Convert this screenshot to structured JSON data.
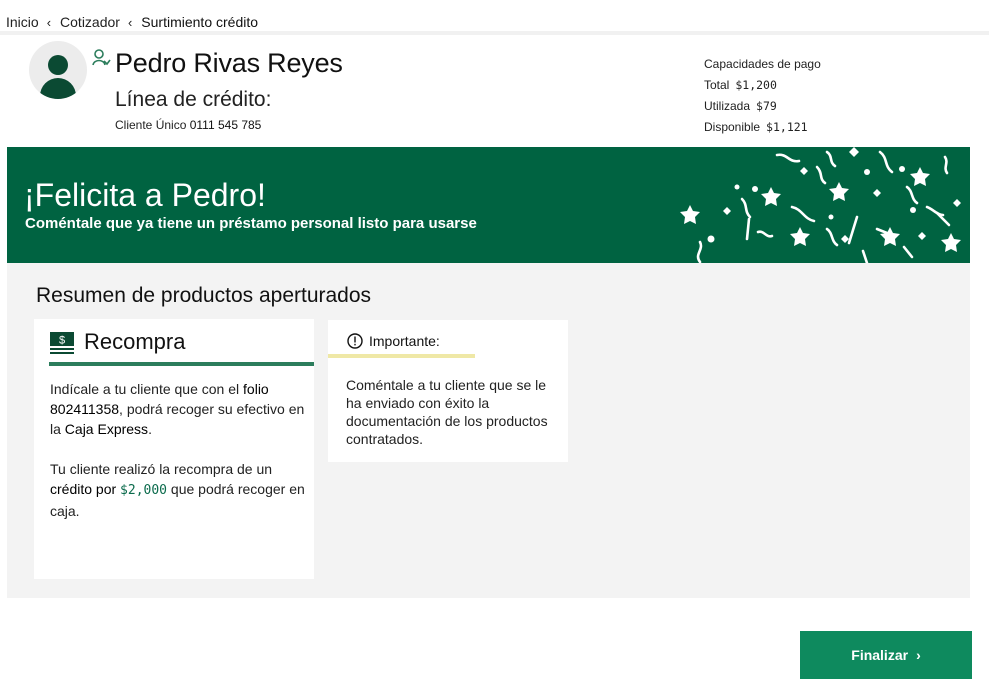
{
  "breadcrumb": {
    "items": [
      "Inicio",
      "Cotizador",
      "Surtimiento crédito"
    ]
  },
  "client": {
    "name": "Pedro Rivas Reyes",
    "line_label": "Línea de crédito:",
    "id_label": "Cliente Único",
    "id_value": "0111 545 785"
  },
  "payment_capacity": {
    "title": "Capacidades de pago",
    "rows": [
      {
        "label": "Total",
        "value": "$1,200"
      },
      {
        "label": "Utilizada",
        "value": "$79"
      },
      {
        "label": "Disponible",
        "value": "$1,121"
      }
    ]
  },
  "banner": {
    "title": "¡Felicita a Pedro!",
    "subtitle": "Coméntale que ya tiene un préstamo personal listo para usarse"
  },
  "summary": {
    "title": "Resumen de productos aperturados",
    "card_recompra": {
      "title": "Recompra",
      "p1_a": "Indícale a tu cliente que con el ",
      "p1_folio_label": "folio",
      "p1_folio": "802411358",
      "p1_b": ", podrá recoger su efectivo en la ",
      "p1_place": "Caja Express",
      "p1_end": ".",
      "p2_a": "Tu cliente realizó la recompra de un ",
      "p2_credit": "crédito por",
      "p2_amount": "$2,000",
      "p2_b": " que podrá recoger en caja."
    },
    "card_important": {
      "title": "Importante:",
      "text": "Coméntale a tu cliente que se le ha enviado con éxito la documentación de los productos contratados."
    }
  },
  "actions": {
    "finish_label": "Finalizar"
  },
  "colors": {
    "banner_green": "#006341",
    "button_green": "#0e8a5e",
    "underline_green": "#2c7d5c",
    "important_underline": "#efe8a6",
    "panel_bg": "#f3f3f3"
  },
  "icons": [
    "chevron-left-icon",
    "user-avatar-icon",
    "user-link-icon",
    "cash-icon",
    "info-circle-icon",
    "chevron-right-icon"
  ]
}
